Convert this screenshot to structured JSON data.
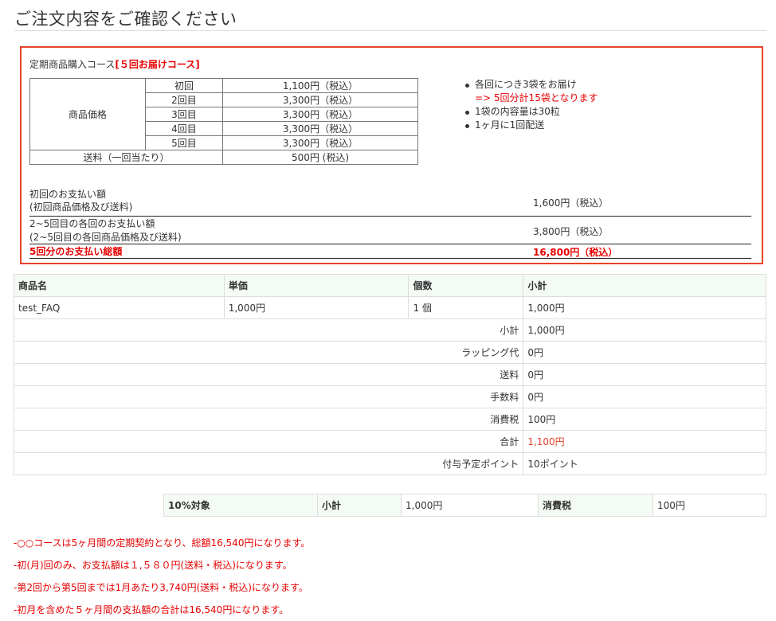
{
  "page": {
    "title": "ご注文内容をご確認ください"
  },
  "course": {
    "label": "定期商品購入コース",
    "name": "[５回お届けコース]",
    "price_label": "商品価格",
    "rows": [
      {
        "n": "初回",
        "price": "1,100円（税込）"
      },
      {
        "n": "2回目",
        "price": "3,300円（税込）"
      },
      {
        "n": "3回目",
        "price": "3,300円（税込）"
      },
      {
        "n": "4回目",
        "price": "3,300円（税込）"
      },
      {
        "n": "5回目",
        "price": "3,300円（税込）"
      }
    ],
    "shipping_label": "送料（一回当たり）",
    "shipping_value": "500円 (税込)",
    "info": [
      "各回につき3袋をお届け",
      "=> 5回分計15袋となります",
      "1袋の内容量は30粒",
      "1ヶ月に1回配送"
    ],
    "payments": {
      "first_label_1": "初回のお支払い額",
      "first_label_2": "(初回商品価格及び送料)",
      "first_value": "1,600円（税込）",
      "rest_label_1": "2~5回目の各回のお支払い額",
      "rest_label_2": "(2~5回目の各回商品価格及び送料)",
      "rest_value": "3,800円（税込）",
      "total_label": "5回分のお支払い総額",
      "total_value": "16,800円（税込）"
    }
  },
  "order": {
    "headers": [
      "商品名",
      "単価",
      "個数",
      "小計"
    ],
    "item": {
      "name": "test_FAQ",
      "price": "1,000円",
      "qty": "1 個",
      "subtotal": "1,000円"
    },
    "summary": [
      {
        "label": "小計",
        "value": "1,000円"
      },
      {
        "label": "ラッピング代",
        "value": "0円"
      },
      {
        "label": "送料",
        "value": "0円"
      },
      {
        "label": "手数料",
        "value": "0円"
      },
      {
        "label": "消費税",
        "value": "100円"
      },
      {
        "label": "合計",
        "value": "1,100円"
      },
      {
        "label": "付与予定ポイント",
        "value": "10ポイント"
      }
    ]
  },
  "tax": {
    "target": "10%対象",
    "subtotal_label": "小計",
    "subtotal_value": "1,000円",
    "tax_label": "消費税",
    "tax_value": "100円"
  },
  "notes": [
    "-○○コースは5ヶ月間の定期契約となり、総額16,540円になります。",
    "-初(月)回のみ、お支払額は１,５８０円(送料・税込)になります。",
    "-第2回から第5回までは1月あたり3,740円(送料・税込)になります。",
    "-初月を含めた５ヶ月間の支払額の合計は16,540円になります。"
  ],
  "colors": {
    "accent_red": "#e60000",
    "border_red": "#e8422a",
    "header_bg": "#f4fbf4"
  }
}
